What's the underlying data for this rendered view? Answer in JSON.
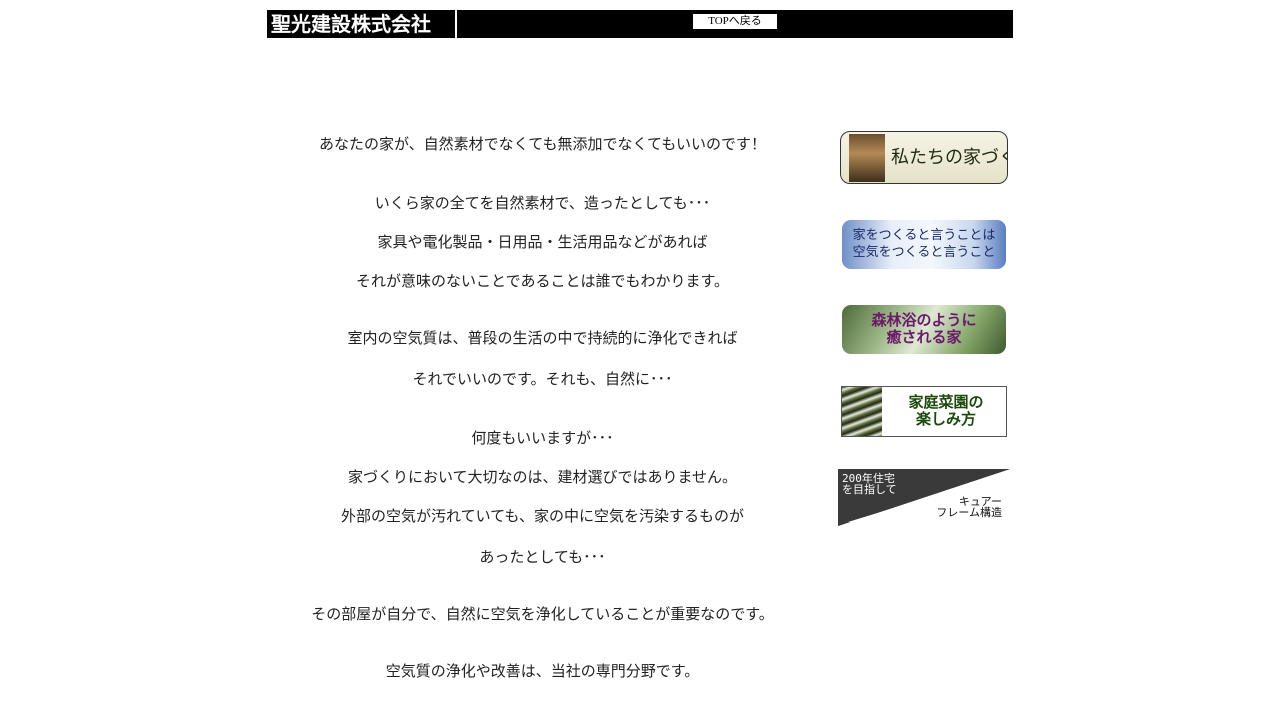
{
  "header": {
    "logo_text": "聖光建設株式会社",
    "top_button_label": "TOPへ戻る"
  },
  "main": {
    "lines": [
      "あなたの家が、自然素材でなくても無添加でなくてもいいのです！",
      "いくら家の全てを自然素材で、造ったとしても･･･",
      "家具や電化製品・日用品・生活用品などがあれば",
      "それが意味のないことであることは誰でもわかります。",
      "室内の空気質は、普段の生活の中で持続的に浄化できれば",
      "それでいいのです。それも、自然に･･･",
      "何度もいいますが･･･",
      "家づくりにおいて大切なのは、建材選びではありません。",
      "外部の空気が汚れていても、家の中に空気を汚染するものが",
      "あったとしても･･･",
      "その部屋が自分で、自然に空気を浄化していることが重要なのです。",
      "空気質の浄化や改善は、当社の専門分野です。"
    ]
  },
  "sidebar": {
    "banners": [
      {
        "label": "私たちの家づくり"
      },
      {
        "label": "家をつくると言うことは\n空気をつくると言うこと"
      },
      {
        "label": "森林浴のように\n癒される家"
      },
      {
        "label": "家庭菜園の\n楽しみ方"
      },
      {
        "label_top": "200年住宅\nを目指して",
        "label_bottom": "キュアー\nフレーム構造"
      }
    ]
  }
}
